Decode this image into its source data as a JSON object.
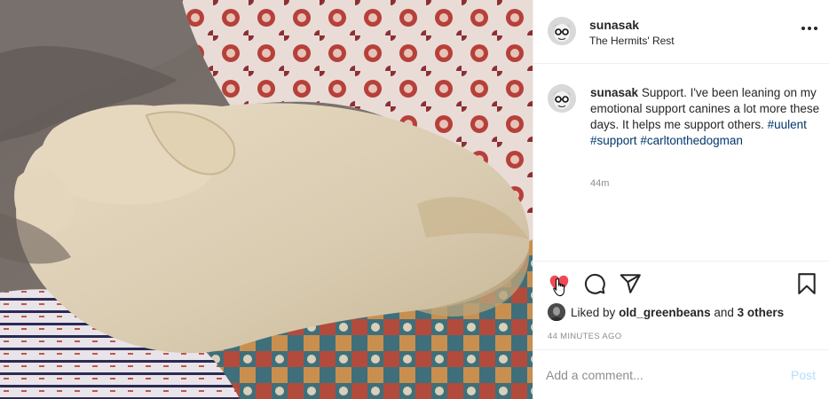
{
  "photo": {
    "subject": "cream-colored dog lying on a bed with patterned quilts"
  },
  "header": {
    "username": "sunasak",
    "location": "The Hermits' Rest",
    "more_icon": "more-horizontal-icon"
  },
  "caption": {
    "username": "sunasak",
    "text": "Support. I've been leaning on my emotional support canines a lot more these days. It helps me support others.",
    "hashtags": [
      "#uulent",
      "#support",
      "#carltonthedogman"
    ],
    "time": "44m"
  },
  "actions": {
    "like_icon": "heart-filled-icon",
    "comment_icon": "comment-bubble-icon",
    "share_icon": "paper-plane-icon",
    "save_icon": "bookmark-icon",
    "liked": true,
    "like_color": "#ed4956"
  },
  "likes": {
    "prefix": "Liked by",
    "user": "old_greenbeans",
    "and": "and",
    "others": "3 others"
  },
  "timestamp": "44 MINUTES AGO",
  "comment": {
    "placeholder": "Add a comment...",
    "post_label": "Post",
    "post_color": "#b2dffc"
  }
}
